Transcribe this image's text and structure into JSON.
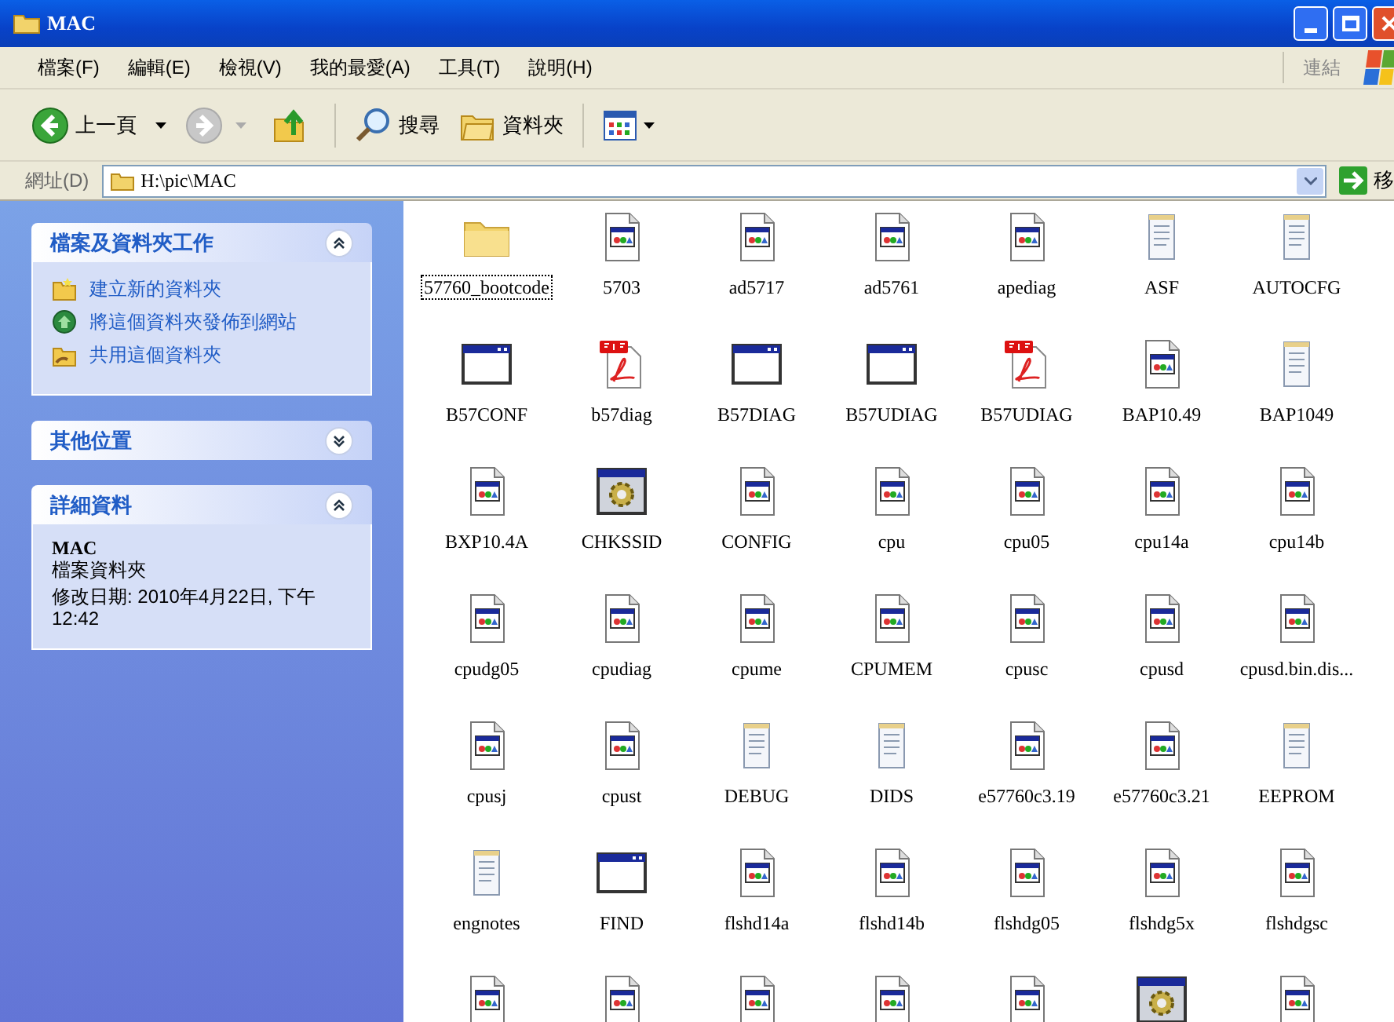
{
  "window": {
    "title": "MAC"
  },
  "menu": [
    "檔案(F)",
    "編輯(E)",
    "檢視(V)",
    "我的最愛(A)",
    "工具(T)",
    "說明(H)"
  ],
  "links_label": "連結",
  "toolbar": [
    {
      "kind": "back",
      "label": "上一頁",
      "disabled": false
    },
    {
      "kind": "forward",
      "disabled": true
    },
    {
      "kind": "up",
      "disabled": false
    },
    {
      "kind": "search",
      "label": "搜尋",
      "disabled": false
    },
    {
      "kind": "folders",
      "label": "資料夾",
      "disabled": false
    },
    {
      "kind": "views",
      "disabled": false
    }
  ],
  "address": {
    "label": "網址(D)",
    "value": "H:\\pic\\MAC",
    "go": "移"
  },
  "sidebar": [
    {
      "kind": "tasks",
      "title": "檔案及資料夾工作",
      "expanded": true,
      "items": [
        {
          "kind": "new-folder",
          "label": "建立新的資料夾"
        },
        {
          "kind": "publish",
          "label": "將這個資料夾發佈到網站"
        },
        {
          "kind": "share",
          "label": "共用這個資料夾"
        }
      ]
    },
    {
      "kind": "places",
      "title": "其他位置",
      "expanded": false
    },
    {
      "kind": "details",
      "title": "詳細資料",
      "expanded": true,
      "name": "MAC",
      "type": "檔案資料夾",
      "modified": "修改日期: 2010年4月22日, 下午12:42"
    }
  ],
  "files": [
    {
      "kind": "folder",
      "name": "57760_bootcode",
      "focused": true
    },
    {
      "kind": "doc",
      "name": "5703",
      "focused": false
    },
    {
      "kind": "doc",
      "name": "ad5717",
      "focused": false
    },
    {
      "kind": "doc",
      "name": "ad5761",
      "focused": false
    },
    {
      "kind": "doc",
      "name": "apediag",
      "focused": false
    },
    {
      "kind": "note",
      "name": "ASF",
      "focused": false
    },
    {
      "kind": "note",
      "name": "AUTOCFG",
      "focused": false
    },
    {
      "kind": "window",
      "name": "B57CONF",
      "focused": false
    },
    {
      "kind": "pdf",
      "name": "b57diag",
      "focused": false
    },
    {
      "kind": "window",
      "name": "B57DIAG",
      "focused": false
    },
    {
      "kind": "window",
      "name": "B57UDIAG",
      "focused": false
    },
    {
      "kind": "pdf",
      "name": "B57UDIAG",
      "focused": false
    },
    {
      "kind": "doc",
      "name": "BAP10.49",
      "focused": false
    },
    {
      "kind": "note",
      "name": "BAP1049",
      "focused": false
    },
    {
      "kind": "doc",
      "name": "BXP10.4A",
      "focused": false
    },
    {
      "kind": "gear",
      "name": "CHKSSID",
      "focused": false
    },
    {
      "kind": "doc",
      "name": "CONFIG",
      "focused": false
    },
    {
      "kind": "doc",
      "name": "cpu",
      "focused": false
    },
    {
      "kind": "doc",
      "name": "cpu05",
      "focused": false
    },
    {
      "kind": "doc",
      "name": "cpu14a",
      "focused": false
    },
    {
      "kind": "doc",
      "name": "cpu14b",
      "focused": false
    },
    {
      "kind": "doc",
      "name": "cpudg05",
      "focused": false
    },
    {
      "kind": "doc",
      "name": "cpudiag",
      "focused": false
    },
    {
      "kind": "doc",
      "name": "cpume",
      "focused": false
    },
    {
      "kind": "doc",
      "name": "CPUMEM",
      "focused": false
    },
    {
      "kind": "doc",
      "name": "cpusc",
      "focused": false
    },
    {
      "kind": "doc",
      "name": "cpusd",
      "focused": false
    },
    {
      "kind": "doc",
      "name": "cpusd.bin.dis...",
      "focused": false
    },
    {
      "kind": "doc",
      "name": "cpusj",
      "focused": false
    },
    {
      "kind": "doc",
      "name": "cpust",
      "focused": false
    },
    {
      "kind": "note",
      "name": "DEBUG",
      "focused": false
    },
    {
      "kind": "note",
      "name": "DIDS",
      "focused": false
    },
    {
      "kind": "doc",
      "name": "e57760c3.19",
      "focused": false
    },
    {
      "kind": "doc",
      "name": "e57760c3.21",
      "focused": false
    },
    {
      "kind": "note",
      "name": "EEPROM",
      "focused": false
    },
    {
      "kind": "note",
      "name": "engnotes",
      "focused": false
    },
    {
      "kind": "window",
      "name": "FIND",
      "focused": false
    },
    {
      "kind": "doc",
      "name": "flshd14a",
      "focused": false
    },
    {
      "kind": "doc",
      "name": "flshd14b",
      "focused": false
    },
    {
      "kind": "doc",
      "name": "flshdg05",
      "focused": false
    },
    {
      "kind": "doc",
      "name": "flshdg5x",
      "focused": false
    },
    {
      "kind": "doc",
      "name": "flshdgsc",
      "focused": false
    },
    {
      "kind": "doc"
    },
    {
      "kind": "doc"
    },
    {
      "kind": "doc"
    },
    {
      "kind": "doc"
    },
    {
      "kind": "doc"
    },
    {
      "kind": "gear"
    },
    {
      "kind": "doc"
    }
  ]
}
